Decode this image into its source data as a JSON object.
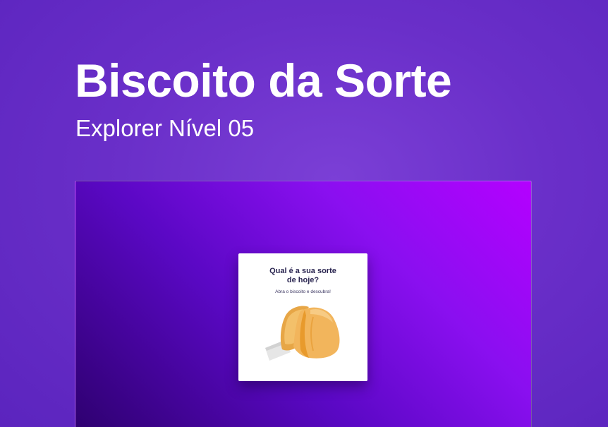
{
  "page": {
    "title": "Biscoito da Sorte",
    "subtitle": "Explorer Nível 05"
  },
  "card": {
    "heading_line1": "Qual é a sua sorte",
    "heading_line2": "de hoje?",
    "hint": "Abra o biscoito e descubra!",
    "cookie_icon": "fortune-cookie-icon"
  },
  "colors": {
    "background": "#6a2fc9",
    "frame_gradient_start": "#b400ff",
    "frame_gradient_end": "#2d006e",
    "card_text": "#2a2550",
    "cookie": "#f2b55c",
    "cookie_dark": "#e89a2c"
  }
}
